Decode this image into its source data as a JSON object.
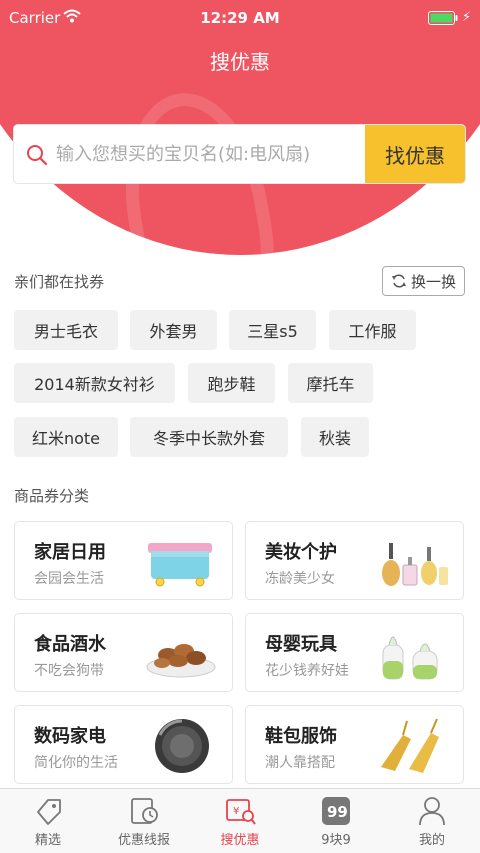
{
  "status": {
    "carrier": "Carrier",
    "time": "12:29 AM"
  },
  "header": {
    "title": "搜优惠"
  },
  "search": {
    "placeholder": "输入您想买的宝贝名(如:电风扇)",
    "button_label": "找优惠"
  },
  "hot": {
    "title": "亲们都在找券",
    "refresh_label": "换一换",
    "tags": [
      "男士毛衣",
      "外套男",
      "三星s5",
      "工作服",
      "2014新款女衬衫",
      "跑步鞋",
      "摩托车",
      "红米note",
      "冬季中长款外套",
      "秋装"
    ]
  },
  "categories": {
    "title": "商品券分类",
    "items": [
      {
        "title": "家居日用",
        "subtitle": "会园会生活"
      },
      {
        "title": "美妆个护",
        "subtitle": "冻龄美少女"
      },
      {
        "title": "食品酒水",
        "subtitle": "不吃会狗带"
      },
      {
        "title": "母婴玩具",
        "subtitle": "花少钱养好娃"
      },
      {
        "title": "数码家电",
        "subtitle": "简化你的生活"
      },
      {
        "title": "鞋包服饰",
        "subtitle": "潮人靠搭配"
      }
    ]
  },
  "tabbar": {
    "items": [
      {
        "label": "精选",
        "icon": "tag-icon"
      },
      {
        "label": "优惠线报",
        "icon": "clock-icon"
      },
      {
        "label": "搜优惠",
        "icon": "search-coupon-icon"
      },
      {
        "label": "9块9",
        "icon": "nine-nine-icon"
      },
      {
        "label": "我的",
        "icon": "user-icon"
      }
    ],
    "active_index": 2
  },
  "colors": {
    "brand_red": "#ee5560",
    "accent_yellow": "#f7c02d",
    "active_tab": "#e8434f"
  }
}
